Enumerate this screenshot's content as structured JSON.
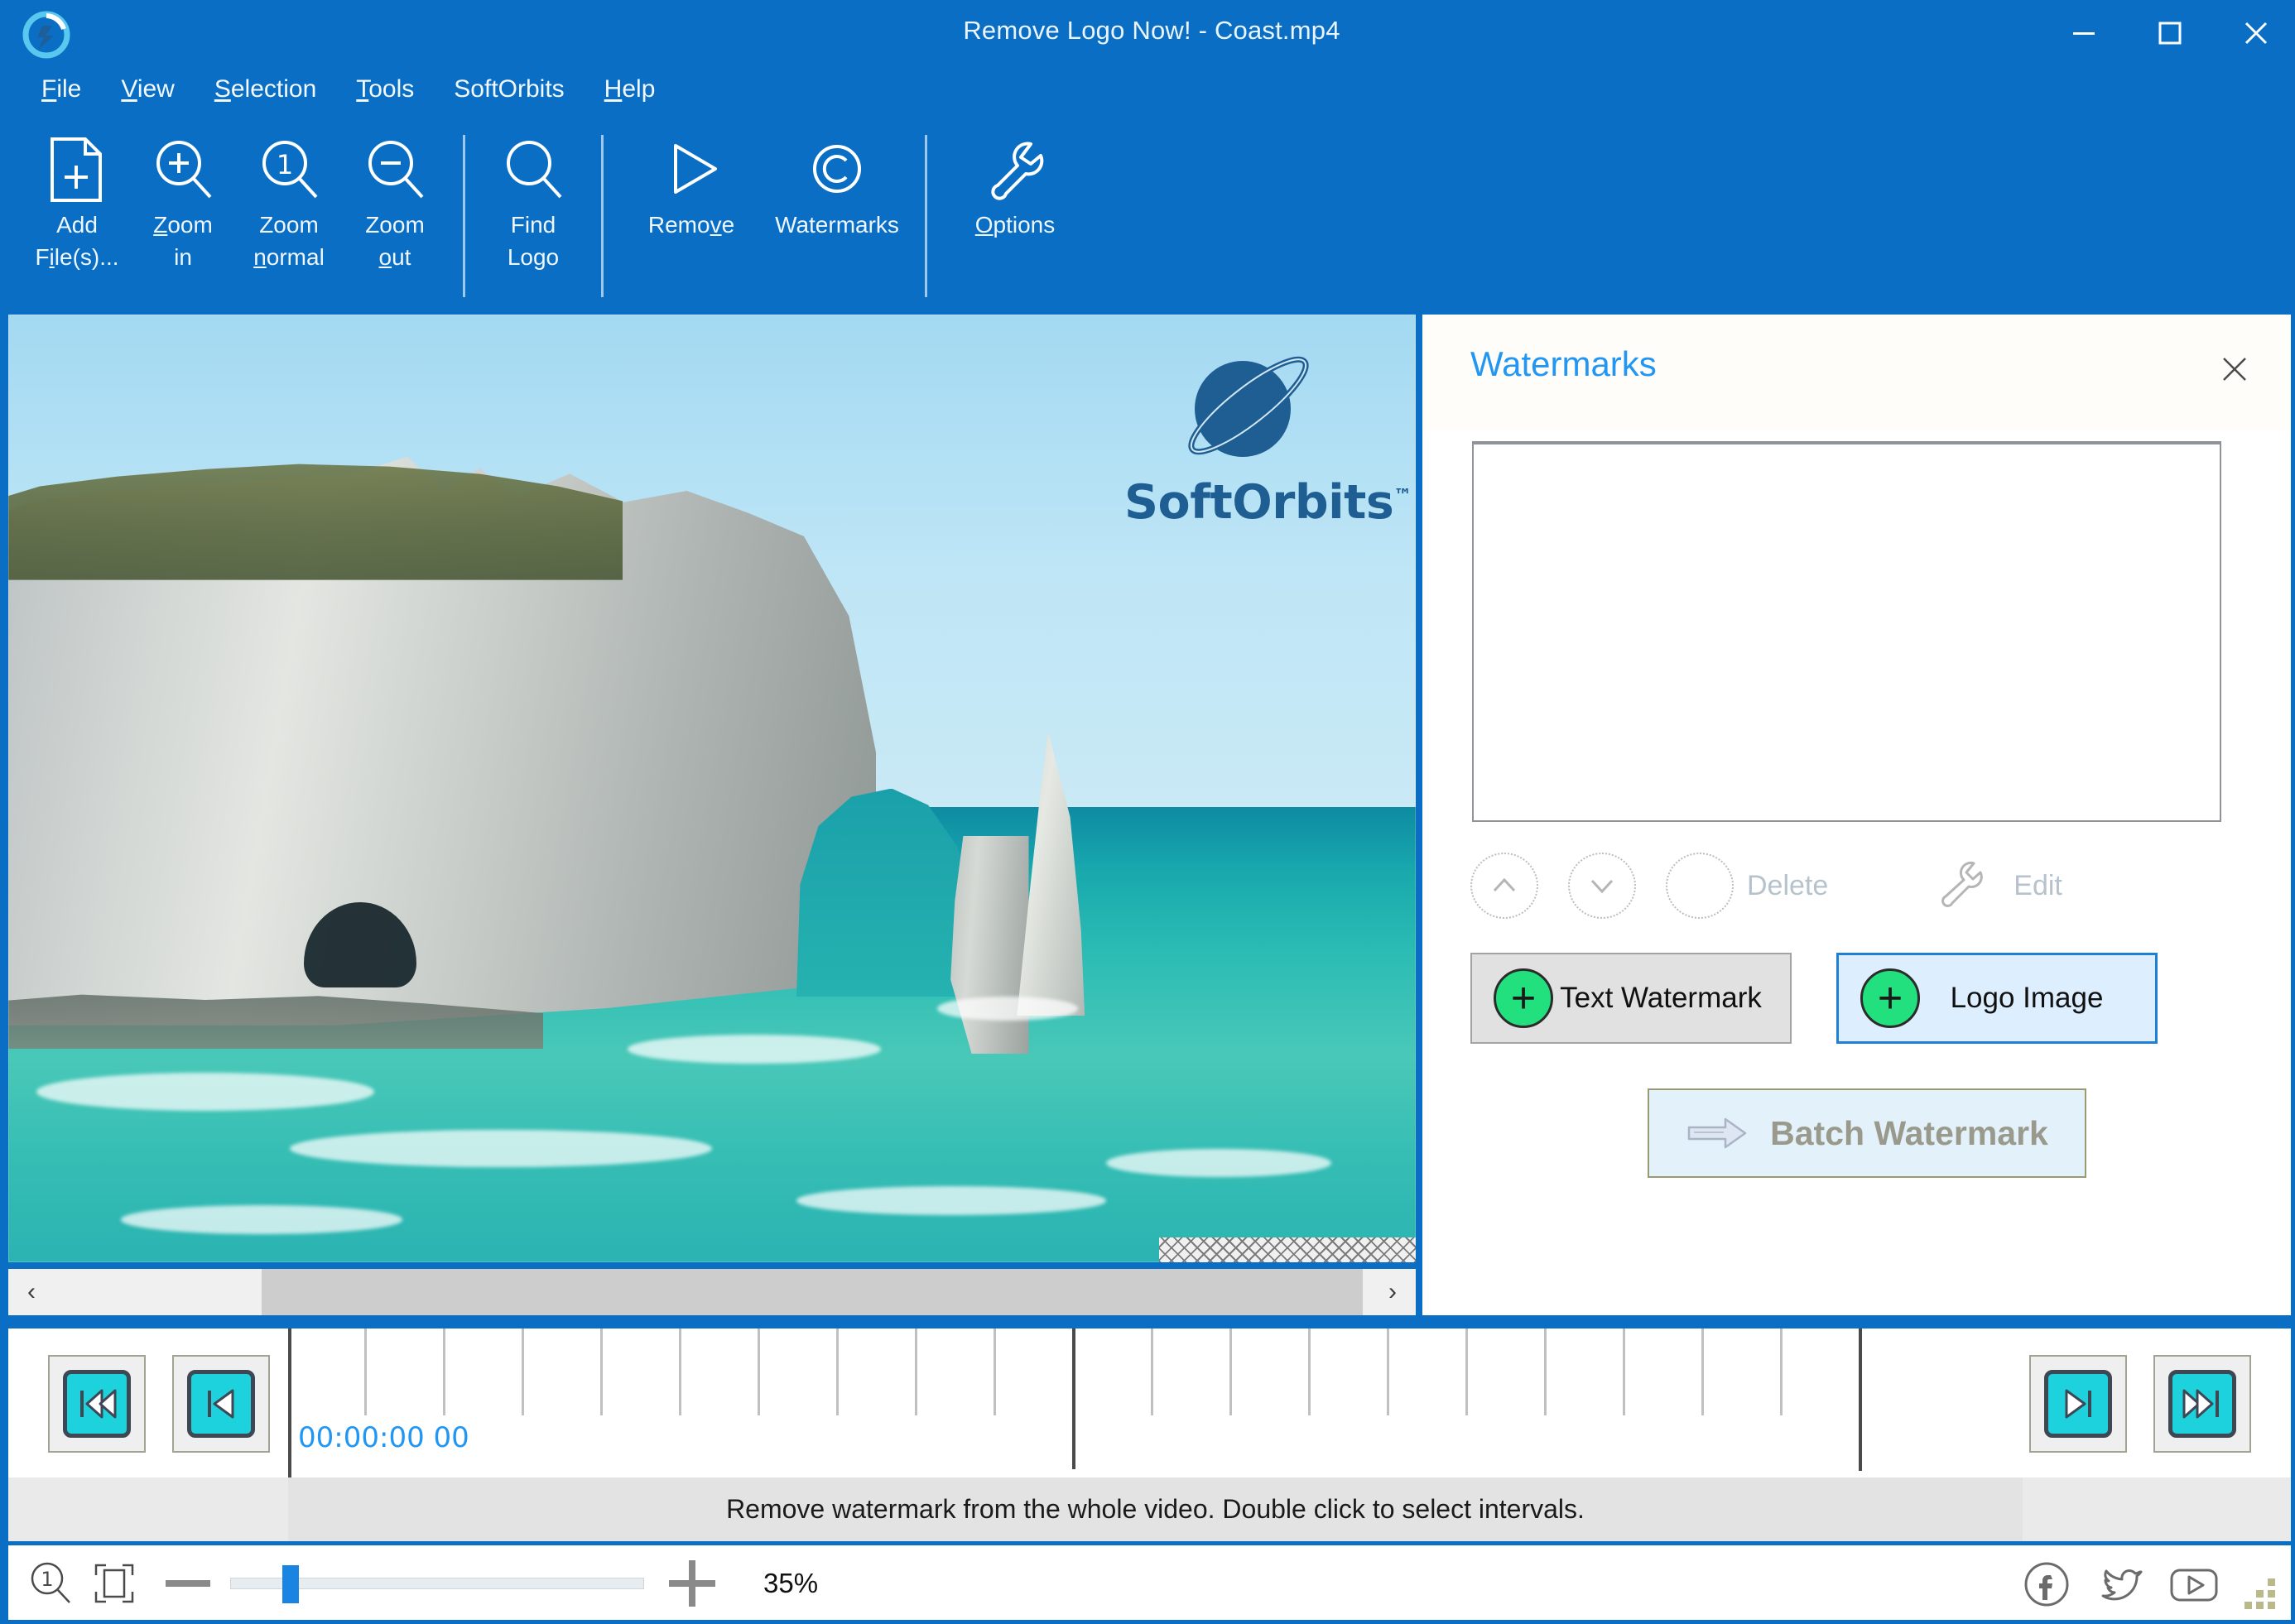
{
  "window": {
    "title": "Remove Logo Now! - Coast.mp4",
    "app_icon": "app-logo-icon",
    "minimize": "–",
    "maximize": "□",
    "close": "✕"
  },
  "menubar": {
    "items": [
      {
        "label": "File",
        "accel": "F"
      },
      {
        "label": "View",
        "accel": "V"
      },
      {
        "label": "Selection",
        "accel": "S"
      },
      {
        "label": "SoftOrbits",
        "accel": ""
      },
      {
        "label": "Tools",
        "accel": "T"
      },
      {
        "label": "Help",
        "accel": "H"
      }
    ],
    "file": "File",
    "view": "View",
    "selection": "Selection",
    "tools": "Tools",
    "softorbits": "SoftOrbits",
    "help": "Help"
  },
  "toolbar": {
    "buttons": [
      {
        "label_line1": "Add",
        "label_line2": "File(s)...",
        "icon": "add-file-icon"
      },
      {
        "label_line1": "Zoom",
        "label_line2": "in",
        "icon": "zoom-in-icon"
      },
      {
        "label_line1": "Zoom",
        "label_line2": "normal",
        "icon": "zoom-normal-icon"
      },
      {
        "label_line1": "Zoom",
        "label_line2": "out",
        "icon": "zoom-out-icon"
      },
      {
        "label_line1": "Find",
        "label_line2": "Logo",
        "icon": "find-logo-icon"
      },
      {
        "label_line1": "Remove",
        "label_line2": "",
        "icon": "remove-play-icon"
      },
      {
        "label_line1": "Watermarks",
        "label_line2": "",
        "icon": "watermarks-copyright-icon"
      },
      {
        "label_line1": "Options",
        "label_line2": "",
        "icon": "options-wrench-icon"
      }
    ]
  },
  "image_view": {
    "file_watermark_text": "SoftOrbits",
    "file_watermark_tm": "™",
    "scroll_left": "‹",
    "scroll_right": "›"
  },
  "watermarks_panel": {
    "title": "Watermarks",
    "close": "✕",
    "list_items": [],
    "move_up": "move-up-button",
    "move_down": "move-down-button",
    "delete_label": "Delete",
    "edit_label": "Edit",
    "text_watermark_label": "Text Watermark",
    "logo_image_label": "Logo Image",
    "batch_watermark_label": "Batch Watermark",
    "plus_glyph": "+"
  },
  "timeline": {
    "timecode": "00:00:00 00",
    "status_text": "Remove watermark from the whole video. Double click to select intervals.",
    "nav_first": "go-to-start",
    "nav_prev": "previous-frame",
    "nav_next": "next-frame",
    "nav_last": "go-to-end"
  },
  "statusbar": {
    "zoom_percent": "35%",
    "zoom_minus": "−",
    "zoom_plus": "+",
    "actual_size_icon": "zoom-actual-size-icon",
    "fit_icon": "fit-to-window-icon",
    "social": [
      {
        "name": "facebook-icon"
      },
      {
        "name": "twitter-icon"
      },
      {
        "name": "youtube-icon"
      }
    ]
  },
  "colors": {
    "accent_blue": "#0a6ec4",
    "panel_title_blue": "#2196f3",
    "green_plus": "#21e07d",
    "cyan_nav": "#1ed2dd",
    "batch_text": "#9a9a8c"
  }
}
